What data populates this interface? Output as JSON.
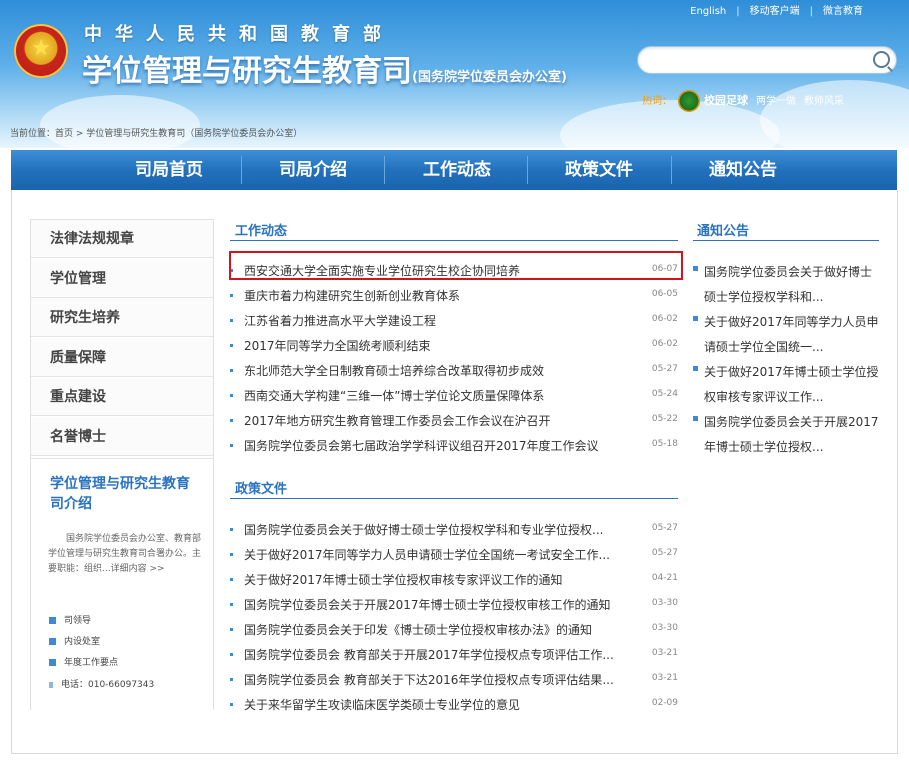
{
  "header": {
    "ministry": "中华人民共和国教育部",
    "title": "学位管理与研究生教育司",
    "subtitle": "(国务院学位委员会办公室)",
    "top_links": [
      "English",
      "移动客户端",
      "微言教育"
    ],
    "hot_label": "热词：",
    "hot_main": "校园足球",
    "hot_tags": [
      "两学一做",
      "教师风采"
    ],
    "search_placeholder": ""
  },
  "breadcrumb": "当前位置：首页 > 学位管理与研究生教育司（国务院学位委员会办公室）",
  "nav": [
    "司局首页",
    "司局介绍",
    "工作动态",
    "政策文件",
    "通知公告"
  ],
  "sidebar": {
    "items": [
      "法律法规规章",
      "学位管理",
      "研究生培养",
      "质量保障",
      "重点建设",
      "名誉博士"
    ],
    "intro_title": "学位管理与研究生教育司介绍",
    "intro_text": "国务院学位委员会办公室、教育部学位管理与研究生教育司合署办公。主要职能：组织...详细内容 >>",
    "links": [
      "司领导",
      "内设处室",
      "年度工作要点",
      "电话：010-66097343"
    ]
  },
  "work": {
    "title": "工作动态",
    "items": [
      {
        "text": "西安交通大学全面实施专业学位研究生校企协同培养",
        "date": "06-07"
      },
      {
        "text": "重庆市着力构建研究生创新创业教育体系",
        "date": "06-05"
      },
      {
        "text": "江苏省着力推进高水平大学建设工程",
        "date": "06-02"
      },
      {
        "text": "2017年同等学力全国统考顺利结束",
        "date": "06-02"
      },
      {
        "text": "东北师范大学全日制教育硕士培养综合改革取得初步成效",
        "date": "05-27"
      },
      {
        "text": "西南交通大学构建“三维一体”博士学位论文质量保障体系",
        "date": "05-24"
      },
      {
        "text": "2017年地方研究生教育管理工作委员会工作会议在沪召开",
        "date": "05-22"
      },
      {
        "text": "国务院学位委员会第七届政治学学科评议组召开2017年度工作会议",
        "date": "05-18"
      }
    ]
  },
  "policy": {
    "title": "政策文件",
    "items": [
      {
        "text": "国务院学位委员会关于做好博士硕士学位授权学科和专业学位授权...",
        "date": "05-27"
      },
      {
        "text": "关于做好2017年同等学力人员申请硕士学位全国统一考试安全工作...",
        "date": "05-27"
      },
      {
        "text": "关于做好2017年博士硕士学位授权审核专家评议工作的通知",
        "date": "04-21"
      },
      {
        "text": "国务院学位委员会关于开展2017年博士硕士学位授权审核工作的通知",
        "date": "03-30"
      },
      {
        "text": "国务院学位委员会关于印发《博士硕士学位授权审核办法》的通知",
        "date": "03-30"
      },
      {
        "text": "国务院学位委员会 教育部关于开展2017年学位授权点专项评估工作...",
        "date": "03-21"
      },
      {
        "text": "国务院学位委员会 教育部关于下达2016年学位授权点专项评估结果...",
        "date": "03-21"
      },
      {
        "text": "关于来华留学生攻读临床医学类硕士专业学位的意见",
        "date": "02-09"
      }
    ]
  },
  "notices": {
    "title": "通知公告",
    "items": [
      "国务院学位委员会关于做好博士硕士学位授权学科和...",
      "关于做好2017年同等学力人员申请硕士学位全国统一...",
      "关于做好2017年博士硕士学位授权审核专家评议工作...",
      "国务院学位委员会关于开展2017年博士硕士学位授权..."
    ]
  }
}
